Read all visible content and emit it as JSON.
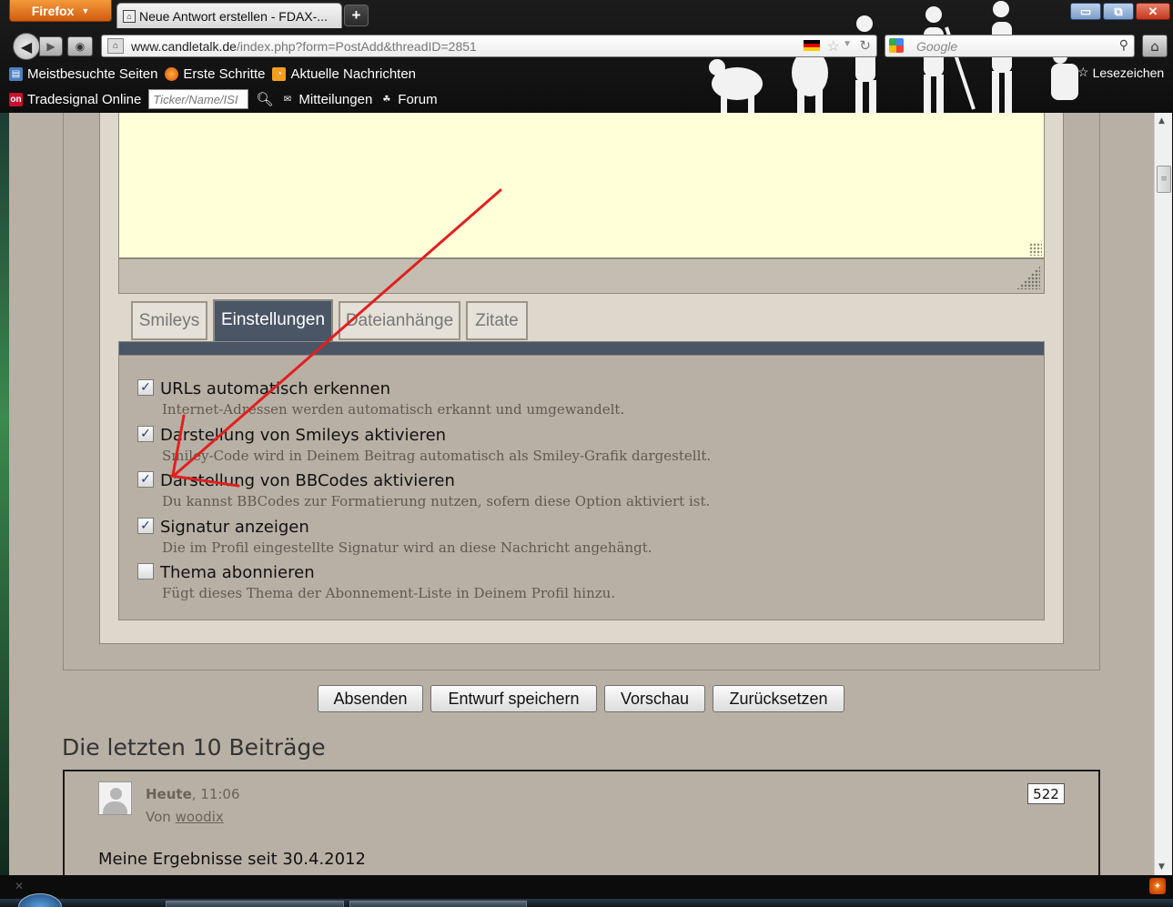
{
  "browser": {
    "app_button": "Firefox",
    "tab_title": "Neue Antwort erstellen - FDAX-...",
    "new_tab_label": "+",
    "url_host": "www.candletalk.de",
    "url_path": "/index.php?form=PostAdd&threadID=2851",
    "search_placeholder": "Google",
    "window_buttons": {
      "minimize": "▭",
      "restore": "⧉",
      "close": "✕"
    },
    "bookmarks_row1": [
      {
        "label": "Meistbesuchte Seiten",
        "icon": "page-icon"
      },
      {
        "label": "Erste Schritte",
        "icon": "firefox-icon"
      },
      {
        "label": "Aktuelle Nachrichten",
        "icon": "rss-icon"
      }
    ],
    "bookmarks_row2": [
      {
        "label": "Tradesignal Online",
        "icon": "tradesignal-icon"
      },
      {
        "label": "Mitteilungen",
        "icon": "mail-icon"
      },
      {
        "label": "Forum",
        "icon": "forum-icon"
      }
    ],
    "ticker_placeholder": "Ticker/Name/ISI",
    "bookmarks_button": "Lesezeichen"
  },
  "editor": {
    "tabs": [
      {
        "label": "Smileys",
        "active": false
      },
      {
        "label": "Einstellungen",
        "active": true
      },
      {
        "label": "Dateianhänge",
        "active": false
      },
      {
        "label": "Zitate",
        "active": false
      }
    ]
  },
  "options": [
    {
      "label": "URLs automatisch erkennen",
      "description": "Internet-Adressen werden automatisch erkannt und umgewandelt.",
      "checked": true
    },
    {
      "label": "Darstellung von Smileys aktivieren",
      "description": "Smiley-Code wird in Deinem Beitrag automatisch als Smiley-Grafik dargestellt.",
      "checked": true
    },
    {
      "label": "Darstellung von BBCodes aktivieren",
      "description": "Du kannst BBCodes zur Formatierung nutzen, sofern diese Option aktiviert ist.",
      "checked": true
    },
    {
      "label": "Signatur anzeigen",
      "description": "Die im Profil eingestellte Signatur wird an diese Nachricht angehängt.",
      "checked": true
    },
    {
      "label": "Thema abonnieren",
      "description": "Fügt dieses Thema der Abonnement-Liste in Deinem Profil hinzu.",
      "checked": false
    }
  ],
  "actions": {
    "submit": "Absenden",
    "save_draft": "Entwurf speichern",
    "preview": "Vorschau",
    "reset": "Zurücksetzen"
  },
  "recent": {
    "heading": "Die letzten 10 Beiträge",
    "post": {
      "date_bold": "Heute",
      "date_rest": ", 11:06",
      "author_prefix": "Von ",
      "author": "woodix",
      "number": "522",
      "text": "Meine Ergebnisse seit 30.4.2012"
    }
  },
  "colors": {
    "page_bg": "#b8b0a4",
    "active_tab": "#4a5566",
    "editor_bg": "#ffffd8",
    "annotation_arrow": "#e02020"
  }
}
